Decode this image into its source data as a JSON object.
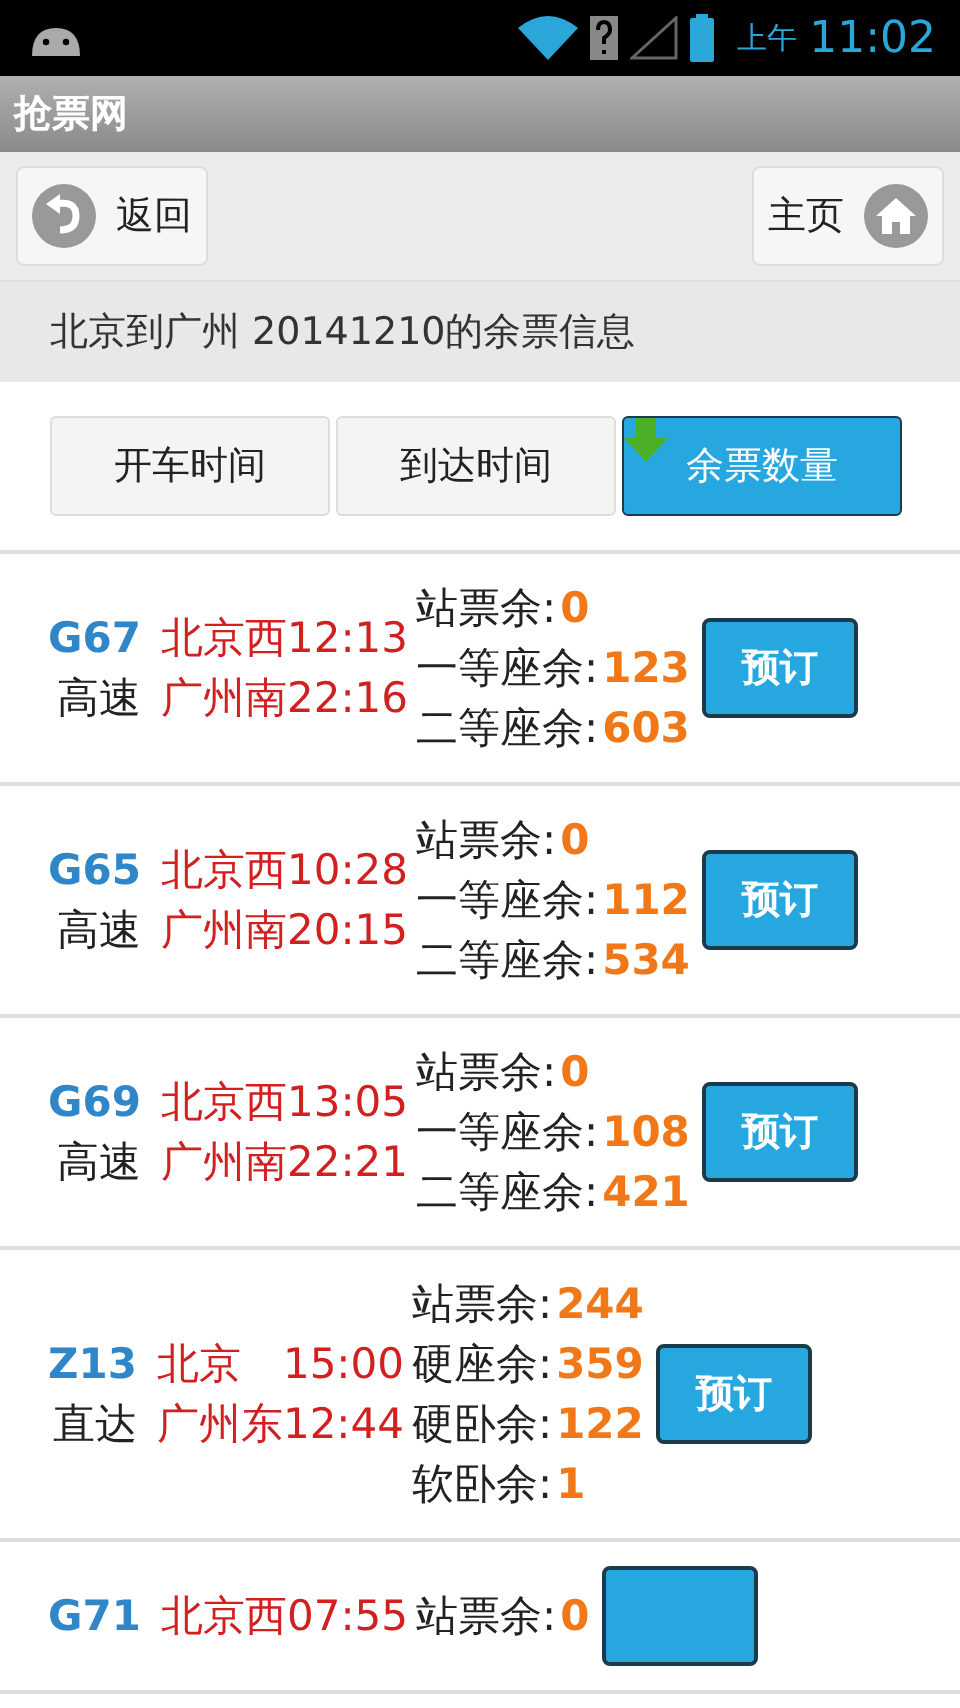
{
  "status_bar": {
    "period": "上午",
    "time": "11:02"
  },
  "app_title": "抢票网",
  "toolbar": {
    "back": "返回",
    "home": "主页"
  },
  "heading": "北京到广州 20141210的余票信息",
  "sort_tabs": [
    {
      "label": "开车时间",
      "selected": false
    },
    {
      "label": "到达时间",
      "selected": false
    },
    {
      "label": "余票数量",
      "selected": true
    }
  ],
  "trains": [
    {
      "code": "G67",
      "type": "高速",
      "from": "北京西",
      "departure": "12:13",
      "to": "广州南",
      "arrival": "22:16",
      "seats": [
        {
          "label": "站票余:",
          "count": "0"
        },
        {
          "label": "一等座余:",
          "count": "123"
        },
        {
          "label": "二等座余:",
          "count": "603"
        }
      ],
      "button": "预订"
    },
    {
      "code": "G65",
      "type": "高速",
      "from": "北京西",
      "departure": "10:28",
      "to": "广州南",
      "arrival": "20:15",
      "seats": [
        {
          "label": "站票余:",
          "count": "0"
        },
        {
          "label": "一等座余:",
          "count": "112"
        },
        {
          "label": "二等座余:",
          "count": "534"
        }
      ],
      "button": "预订"
    },
    {
      "code": "G69",
      "type": "高速",
      "from": "北京西",
      "departure": "13:05",
      "to": "广州南",
      "arrival": "22:21",
      "seats": [
        {
          "label": "站票余:",
          "count": "0"
        },
        {
          "label": "一等座余:",
          "count": "108"
        },
        {
          "label": "二等座余:",
          "count": "421"
        }
      ],
      "button": "预订"
    },
    {
      "code": "Z13",
      "type": "直达",
      "from": "北京",
      "departure": "15:00",
      "to": "广州东",
      "arrival": "12:44",
      "seats": [
        {
          "label": "站票余:",
          "count": "244"
        },
        {
          "label": "硬座余:",
          "count": "359"
        },
        {
          "label": "硬卧余:",
          "count": "122"
        },
        {
          "label": "软卧余:",
          "count": "1"
        }
      ],
      "button": "预订"
    },
    {
      "code": "G71",
      "from": "北京西",
      "departure": "07:55",
      "seats": [
        {
          "label": "站票余:",
          "count": "0"
        }
      ]
    }
  ]
}
